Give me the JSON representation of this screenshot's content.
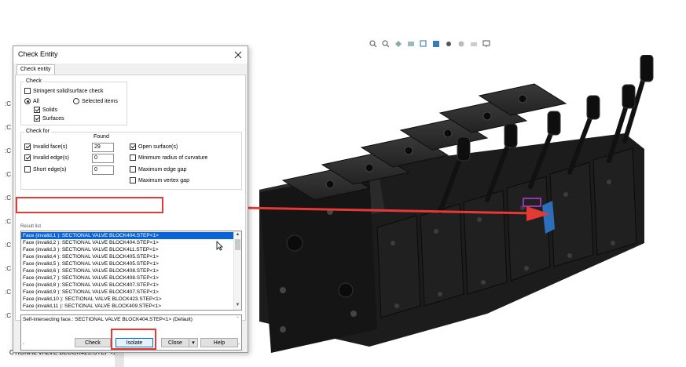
{
  "dialog": {
    "title": "Check Entity",
    "tab_label": "Check entity",
    "check_group": {
      "legend": "Check",
      "stringent": {
        "label": "Stringent solid/surface check",
        "checked": false
      },
      "all": {
        "label": "All",
        "selected": true
      },
      "selected_items": {
        "label": "Selected items",
        "selected": false
      },
      "solids": {
        "label": "Solids",
        "checked": true
      },
      "surfaces": {
        "label": "Surfaces",
        "checked": true
      }
    },
    "check_for_group": {
      "legend": "Check for",
      "found_header": "Found",
      "invalid_faces": {
        "label": "Invalid face(s)",
        "checked": true,
        "found": "29"
      },
      "invalid_edges": {
        "label": "Invalid edge(s)",
        "checked": true,
        "found": "0"
      },
      "short_edges": {
        "label": "Short edge(s)",
        "checked": false,
        "found": "0"
      },
      "open_surfaces": {
        "label": "Open surface(s)",
        "checked": true
      },
      "min_radius": {
        "label": "Minimum radius of curvature",
        "checked": false
      },
      "max_edge_gap": {
        "label": "Maximum edge gap",
        "checked": false
      },
      "max_vertex_gap": {
        "label": "Maximum vertex gap",
        "checked": false
      }
    },
    "result_list": {
      "label": "Result list",
      "items": [
        "Face (invalid,1  ): SECTIONAL VALVE BLOCK404.STEP<1>",
        "Face (invalid,2  ): SECTIONAL VALVE BLOCK404.STEP<1>",
        "Face (invalid,3  ): SECTIONAL VALVE BLOCK411.STEP<1>",
        "Face (invalid,4  ): SECTIONAL VALVE BLOCK405.STEP<1>",
        "Face (invalid,5  ): SECTIONAL VALVE BLOCK405.STEP<1>",
        "Face (invalid,6  ): SECTIONAL VALVE BLOCK408.STEP<1>",
        "Face (invalid,7  ): SECTIONAL VALVE BLOCK408.STEP<1>",
        "Face (invalid,8  ): SECTIONAL VALVE BLOCK407.STEP<1>",
        "Face (invalid,9  ): SECTIONAL VALVE BLOCK407.STEP<1>",
        "Face (invalid,10 ): SECTIONAL VALVE BLOCK423.STEP<1>",
        "Face (invalid,11 ): SECTIONAL VALVE BLOCK409.STEP<1>"
      ]
    },
    "detail_text": "Self-intersecting face.: SECTIONAL VALVE BLOCK404.STEP<1> (Default)",
    "buttons": {
      "check": "Check",
      "isolate": "Isolate",
      "close": "Close",
      "help": "Help"
    }
  },
  "tree": {
    "bottom_item": "CTIONAL VALVE BLOCK425.STEP<1>"
  },
  "colors": {
    "highlight": "#0a64d6",
    "callout": "#e53935",
    "model": "#1c1c1c"
  },
  "toolbar_icons": [
    "zoom-fit-icon",
    "zoom-area-icon",
    "previous-view-icon",
    "section-view-icon",
    "view-orientation-icon",
    "display-style-icon",
    "hide-show-icon",
    "appearance-icon",
    "scene-icon",
    "display-icon"
  ]
}
